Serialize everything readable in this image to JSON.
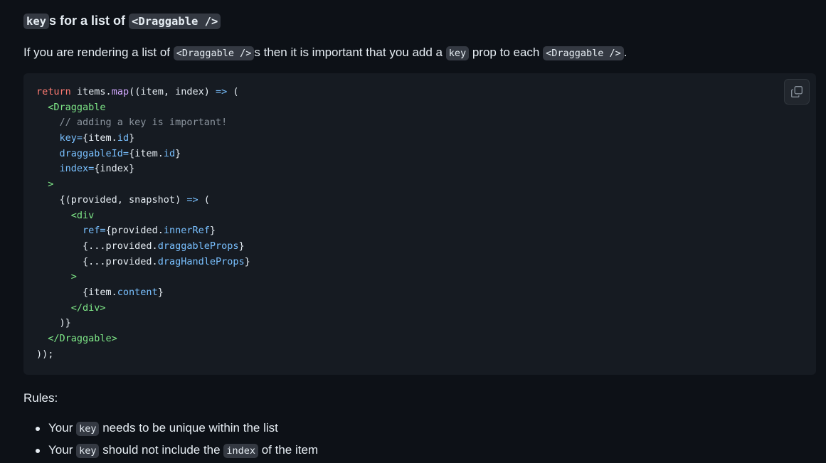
{
  "heading": {
    "code1": "key",
    "text1": "s for a list of ",
    "code2": "<Draggable />"
  },
  "intro": {
    "text1": "If you are rendering a list of ",
    "code1": "<Draggable />",
    "text2": "s then it is important that you add a ",
    "code2": "key",
    "text3": " prop to each ",
    "code3": "<Draggable />",
    "text4": "."
  },
  "code_block": {
    "copy_icon": "copy-icon",
    "lines": [
      [
        {
          "t": "return",
          "c": "kw"
        },
        {
          "t": " items.",
          "c": "plain"
        },
        {
          "t": "map",
          "c": "fn"
        },
        {
          "t": "((item, index) ",
          "c": "plain"
        },
        {
          "t": "=>",
          "c": "op"
        },
        {
          "t": " (",
          "c": "plain"
        }
      ],
      [
        {
          "t": "  <Draggable",
          "c": "tag"
        }
      ],
      [
        {
          "t": "    // adding a key is important!",
          "c": "comment"
        }
      ],
      [
        {
          "t": "    key",
          "c": "attr"
        },
        {
          "t": "=",
          "c": "op"
        },
        {
          "t": "{item.",
          "c": "plain"
        },
        {
          "t": "id",
          "c": "prop"
        },
        {
          "t": "}",
          "c": "plain"
        }
      ],
      [
        {
          "t": "    draggableId",
          "c": "attr"
        },
        {
          "t": "=",
          "c": "op"
        },
        {
          "t": "{item.",
          "c": "plain"
        },
        {
          "t": "id",
          "c": "prop"
        },
        {
          "t": "}",
          "c": "plain"
        }
      ],
      [
        {
          "t": "    index",
          "c": "attr"
        },
        {
          "t": "=",
          "c": "op"
        },
        {
          "t": "{index}",
          "c": "plain"
        }
      ],
      [
        {
          "t": "  >",
          "c": "tag"
        }
      ],
      [
        {
          "t": "    {(provided, snapshot) ",
          "c": "plain"
        },
        {
          "t": "=>",
          "c": "op"
        },
        {
          "t": " (",
          "c": "plain"
        }
      ],
      [
        {
          "t": "      <div",
          "c": "tag"
        }
      ],
      [
        {
          "t": "        ref",
          "c": "attr"
        },
        {
          "t": "=",
          "c": "op"
        },
        {
          "t": "{provided.",
          "c": "plain"
        },
        {
          "t": "innerRef",
          "c": "prop"
        },
        {
          "t": "}",
          "c": "plain"
        }
      ],
      [
        {
          "t": "        {...provided.",
          "c": "plain"
        },
        {
          "t": "draggableProps",
          "c": "prop"
        },
        {
          "t": "}",
          "c": "plain"
        }
      ],
      [
        {
          "t": "        {...provided.",
          "c": "plain"
        },
        {
          "t": "dragHandleProps",
          "c": "prop"
        },
        {
          "t": "}",
          "c": "plain"
        }
      ],
      [
        {
          "t": "      >",
          "c": "tag"
        }
      ],
      [
        {
          "t": "        {item.",
          "c": "plain"
        },
        {
          "t": "content",
          "c": "prop"
        },
        {
          "t": "}",
          "c": "plain"
        }
      ],
      [
        {
          "t": "      </div>",
          "c": "tag"
        }
      ],
      [
        {
          "t": "    )}",
          "c": "plain"
        }
      ],
      [
        {
          "t": "  </Draggable>",
          "c": "tag"
        }
      ],
      [
        {
          "t": "));",
          "c": "plain"
        }
      ]
    ]
  },
  "rules": {
    "label": "Rules:",
    "items": [
      {
        "text1": "Your ",
        "code1": "key",
        "text2": " needs to be unique within the list"
      },
      {
        "text1": "Your ",
        "code1": "key",
        "text2": " should not include the ",
        "code2": "index",
        "text3": " of the item"
      }
    ]
  },
  "colors": {
    "background": "#0d1117",
    "code_background": "#161b22",
    "inline_code_background": "#343942",
    "text": "#e6edf3",
    "keyword": "#ff7b72",
    "function": "#d2a8ff",
    "operator": "#79c0ff",
    "tag": "#7ee787",
    "comment": "#8b949e",
    "attr": "#79c0ff",
    "prop": "#79c0ff",
    "plain": "#e6edf3"
  }
}
